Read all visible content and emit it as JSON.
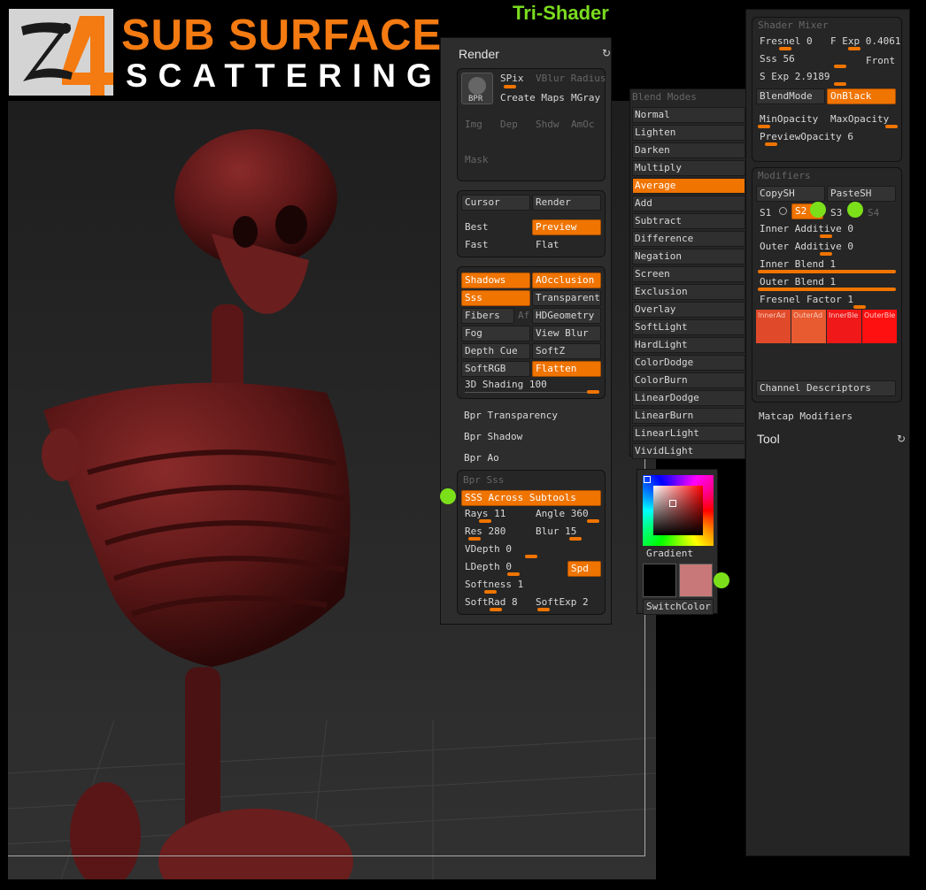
{
  "header": {
    "logo_text": "Z4",
    "title_main": "SUB SURFACE",
    "title_sub": "SCATTERING",
    "tri_shader": "Tri-Shader"
  },
  "render_panel": {
    "title": "Render",
    "bpr": "BPR",
    "spix": "SPix",
    "vblur_radius": "VBlur Radius",
    "create_maps": "Create Maps",
    "mgray": "MGray",
    "img": "Img",
    "dep": "Dep",
    "shdw": "Shdw",
    "amoc": "AmOc",
    "mask": "Mask",
    "cursor": "Cursor",
    "render": "Render",
    "best": "Best",
    "preview": "Preview",
    "fast": "Fast",
    "flat": "Flat",
    "shadows": "Shadows",
    "aocclusion": "AOcclusion",
    "sss": "Sss",
    "transparent": "Transparent",
    "fibers": "Fibers",
    "af": "Af",
    "hdgeometry": "HDGeometry",
    "fog": "Fog",
    "view_blur": "View Blur",
    "depth_cue": "Depth Cue",
    "softz": "SoftZ",
    "softrgb": "SoftRGB",
    "flatten": "Flatten",
    "shading_3d": "3D Shading 100",
    "bpr_transparency": "Bpr Transparency",
    "bpr_shadow": "Bpr Shadow",
    "bpr_ao": "Bpr Ao",
    "bpr_sss": "Bpr Sss",
    "sss_across": "SSS Across Subtools",
    "rays": "Rays 11",
    "angle": "Angle 360",
    "res": "Res 280",
    "blur": "Blur 15",
    "vdepth": "VDepth 0",
    "ldepth": "LDepth 0",
    "spd": "Spd",
    "softness": "Softness 1",
    "softrad": "SoftRad 8",
    "softexp": "SoftExp 2"
  },
  "blend_modes": {
    "title": "Blend Modes",
    "items": [
      "Normal",
      "Lighten",
      "Darken",
      "Multiply",
      "Average",
      "Add",
      "Subtract",
      "Difference",
      "Negation",
      "Screen",
      "Exclusion",
      "Overlay",
      "SoftLight",
      "HardLight",
      "ColorDodge",
      "ColorBurn",
      "LinearDodge",
      "LinearBurn",
      "LinearLight",
      "VividLight"
    ],
    "selected": "Average"
  },
  "color_picker": {
    "gradient": "Gradient",
    "switch_color": "SwitchColor",
    "secondary_color": "#c87878"
  },
  "shader_mixer": {
    "title": "Shader Mixer",
    "fresnel": "Fresnel 0",
    "f_exp": "F Exp 0.4061",
    "sss": "Sss 56",
    "front": "Front",
    "s_exp": "S Exp 2.9189",
    "blendmode": "BlendMode",
    "onblack": "OnBlack",
    "minopacity": "MinOpacity",
    "maxopacity": "MaxOpacity",
    "previewopacity": "PreviewOpacity 6"
  },
  "modifiers": {
    "title": "Modifiers",
    "copysh": "CopySH",
    "pastesh": "PasteSH",
    "s1": "S1",
    "s2": "S2",
    "s3": "S3",
    "s4": "S4",
    "inner_additive": "Inner Additive 0",
    "outer_additive": "Outer Additive 0",
    "inner_blend": "Inner Blend 1",
    "outer_blend": "Outer Blend 1",
    "fresnel_factor": "Fresnel Factor 1",
    "swatches": [
      "InnerAd",
      "OuterAd",
      "InnerBle",
      "OuterBle"
    ],
    "channel_descriptors": "Channel Descriptors",
    "matcap_modifiers": "Matcap Modifiers",
    "tool": "Tool"
  },
  "colors": {
    "accent": "#f07400",
    "green": "#7be01a",
    "title_orange": "#f47a12"
  }
}
